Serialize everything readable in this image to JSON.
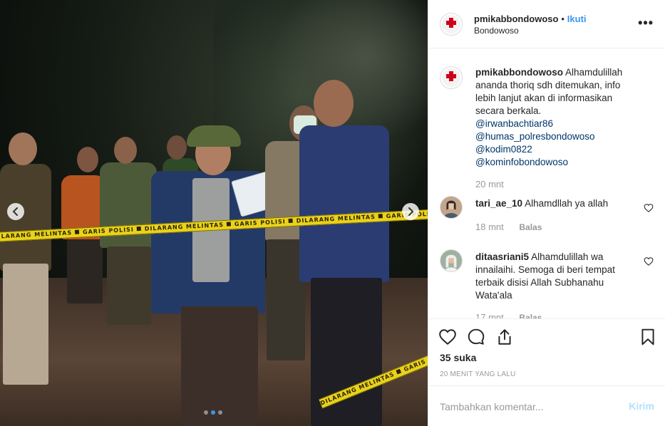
{
  "post": {
    "username": "pmikabbondowoso",
    "separator": "•",
    "follow_label": "Ikuti",
    "location": "Bondowoso",
    "more_icon": "more-horizontal-icon"
  },
  "photo": {
    "tape_text": "DILARANG MELINTAS  ⯀  GARIS POLISI  ⯀  DILARANG MELINTAS  ⯀  GARIS POLISI  ⯀  DILARANG MELINTAS  ⯀  GARIS POLISI",
    "prev_icon": "chevron-left-icon",
    "next_icon": "chevron-right-icon",
    "carousel_dots": 3,
    "carousel_active": 1
  },
  "caption": {
    "username": "pmikabbondowoso",
    "text": "Alhamdulillah ananda thoriq sdh ditemukan, info lebih lanjut akan di informasikan secara berkala.",
    "mentions": [
      "@irwanbachtiar86",
      "@humas_polresbondowoso",
      "@kodim0822",
      "@kominfobondowoso"
    ],
    "time": "20 mnt"
  },
  "comments": [
    {
      "username": "tari_ae_10",
      "text": "Alhamdllah ya allah",
      "time": "18 mnt",
      "reply_label": "Balas"
    },
    {
      "username": "ditaasriani5",
      "text": "Alhamdulillah wa innailaihi. Semoga di beri tempat terbaik disisi Allah Subhanahu Wata'ala",
      "time": "17 mnt",
      "reply_label": "Balas"
    }
  ],
  "actions": {
    "like_icon": "heart-icon",
    "comment_icon": "comment-icon",
    "share_icon": "share-icon",
    "save_icon": "bookmark-icon",
    "likes_text": "35 suka",
    "time_ago": "20 MENIT YANG LALU"
  },
  "add_comment": {
    "placeholder": "Tambahkan komentar...",
    "post_label": "Kirim"
  },
  "colors": {
    "link_blue": "#3897f0",
    "mention_blue": "#003569",
    "post_disabled": "#b2dffc",
    "tape_yellow": "#e9d21b"
  }
}
